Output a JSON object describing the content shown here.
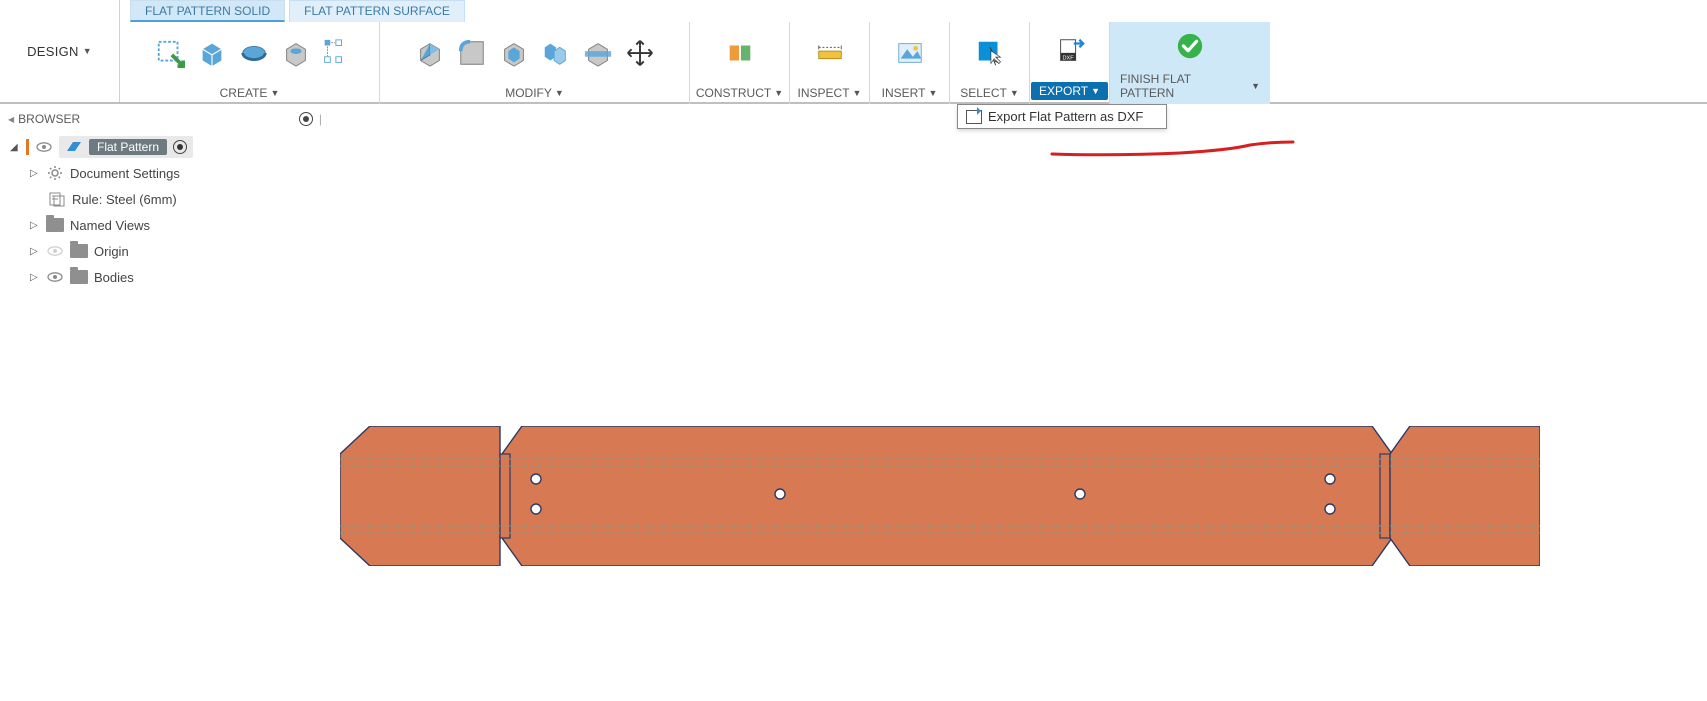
{
  "workspace": {
    "label": "DESIGN"
  },
  "context_tabs": [
    {
      "label": "FLAT PATTERN SOLID",
      "active": true
    },
    {
      "label": "FLAT PATTERN SURFACE",
      "active": false
    }
  ],
  "ribbon": {
    "create": {
      "label": "CREATE"
    },
    "modify": {
      "label": "MODIFY"
    },
    "construct": {
      "label": "CONSTRUCT"
    },
    "inspect": {
      "label": "INSPECT"
    },
    "insert": {
      "label": "INSERT"
    },
    "select": {
      "label": "SELECT"
    },
    "export": {
      "label": "EXPORT",
      "active": true,
      "dropdown_item": "Export Flat Pattern as DXF"
    },
    "finish": {
      "label": "FINISH FLAT PATTERN"
    }
  },
  "browser": {
    "title": "BROWSER",
    "root": "Flat Pattern",
    "nodes": {
      "doc_settings": "Document Settings",
      "rule": "Rule: Steel (6mm)",
      "named_views": "Named Views",
      "origin": "Origin",
      "bodies": "Bodies"
    }
  }
}
